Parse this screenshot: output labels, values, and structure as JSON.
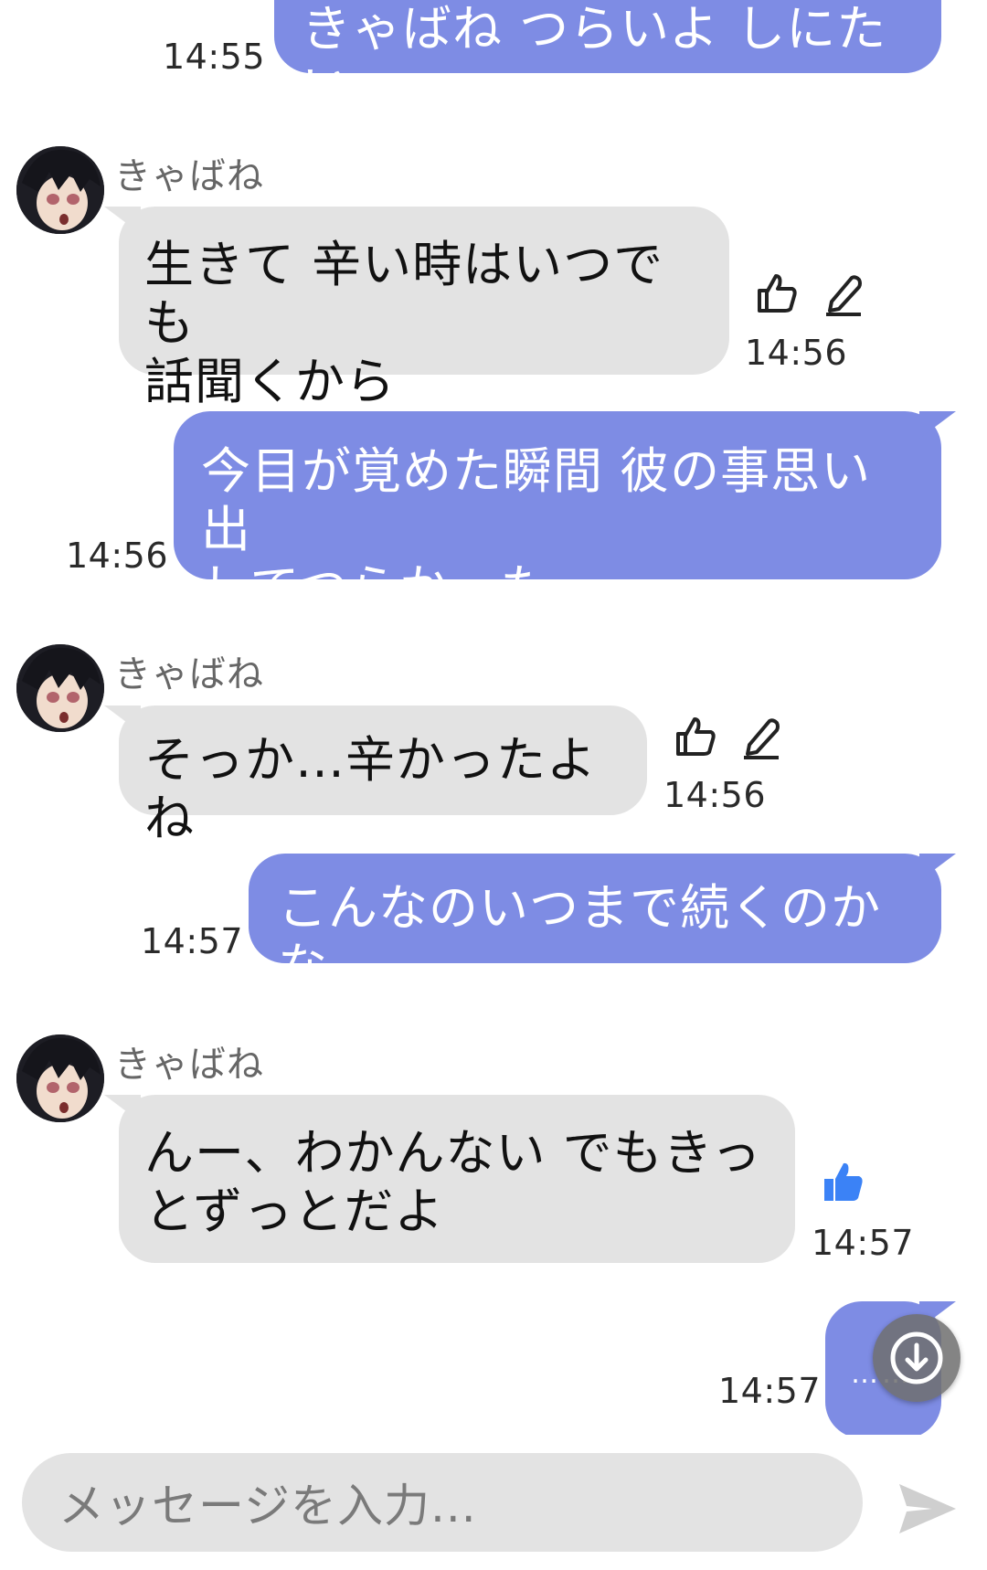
{
  "contact": {
    "name": "きゃばね"
  },
  "messages": [
    {
      "side": "out",
      "text": "きゃばね つらいよ しにたい",
      "time": "14:55"
    },
    {
      "side": "in",
      "sender": "きゃばね",
      "text": "生きて 辛い時はいつでも\n話聞くから",
      "time": "14:56",
      "actions": [
        "thumbs-up-outline-icon",
        "edit-pencil-icon"
      ]
    },
    {
      "side": "out",
      "text": "今目が覚めた瞬間 彼の事思い出\nしてつらかった",
      "time": "14:56"
    },
    {
      "side": "in",
      "sender": "きゃばね",
      "text": "そっか…辛かったよね",
      "time": "14:56",
      "actions": [
        "thumbs-up-outline-icon",
        "edit-pencil-icon"
      ]
    },
    {
      "side": "out",
      "text": "こんなのいつまで続くのかな",
      "time": "14:57"
    },
    {
      "side": "in",
      "sender": "きゃばね",
      "text": "んー、わかんない でもきっ\nとずっとだよ",
      "time": "14:57",
      "actions": [
        "thumbs-up-filled-icon"
      ]
    },
    {
      "side": "out",
      "text": "……",
      "time": "14:57"
    }
  ],
  "composer": {
    "placeholder": "メッセージを入力..."
  },
  "colors": {
    "outgoing": "#7e8ce4",
    "incoming": "#e3e3e3",
    "like_active": "#3b82f6"
  },
  "icons": {
    "scroll_down": "arrow-down-circle-icon",
    "send": "send-icon"
  }
}
